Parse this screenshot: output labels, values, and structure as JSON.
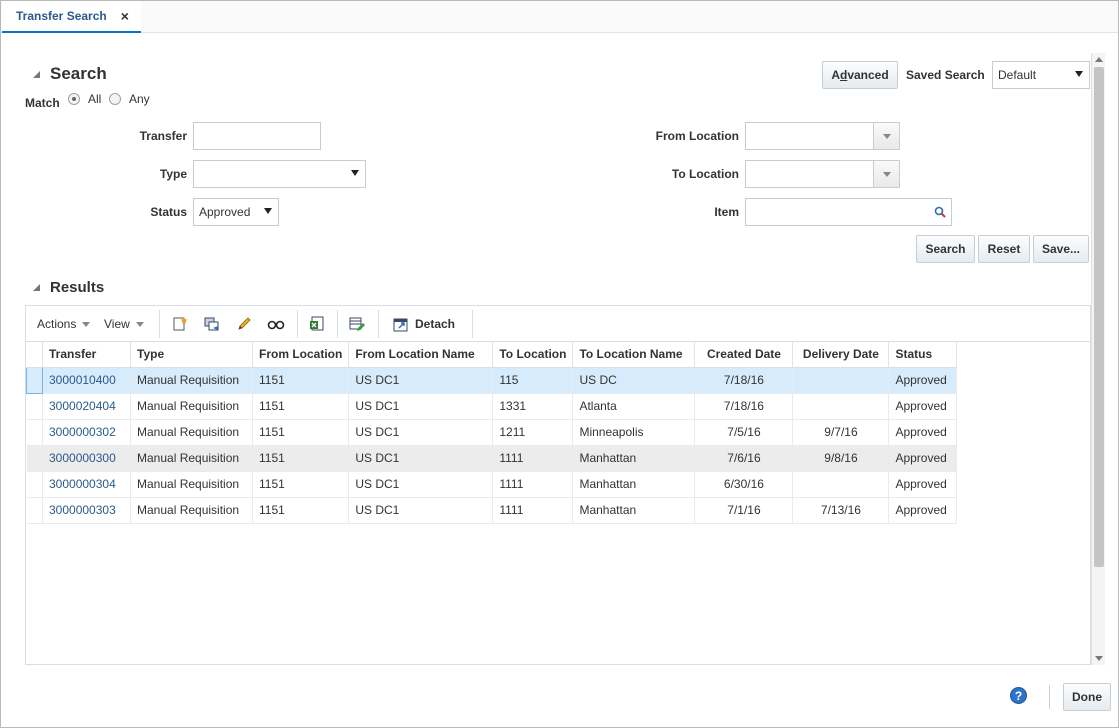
{
  "tab": {
    "label": "Transfer Search",
    "close_glyph": "×"
  },
  "search": {
    "title": "Search",
    "advanced_label_pre": "A",
    "advanced_label_u": "d",
    "advanced_label_post": "vanced",
    "saved_search_label": "Saved Search",
    "saved_search_value": "Default",
    "match_label": "Match",
    "match_all": "All",
    "match_any": "Any",
    "match_selected": "All",
    "fields": {
      "transfer_label": "Transfer",
      "transfer_value": "",
      "type_label": "Type",
      "type_value": "",
      "status_label": "Status",
      "status_value": "Approved",
      "from_location_label": "From Location",
      "from_location_value": "",
      "to_location_label": "To Location",
      "to_location_value": "",
      "item_label": "Item",
      "item_value": ""
    },
    "buttons": {
      "search": "Search",
      "reset": "Reset",
      "save": "Save..."
    }
  },
  "results": {
    "title": "Results",
    "toolbar": {
      "actions": "Actions",
      "view": "View",
      "detach": "Detach"
    },
    "columns": [
      "Transfer",
      "Type",
      "From Location",
      "From Location Name",
      "To Location",
      "To Location Name",
      "Created Date",
      "Delivery Date",
      "Status"
    ],
    "rows": [
      {
        "transfer": "3000010400",
        "type": "Manual Requisition",
        "from_loc": "1151",
        "from_name": "US DC1",
        "to_loc": "115",
        "to_name": "US DC",
        "created": "7/18/16",
        "delivery": "",
        "status": "Approved"
      },
      {
        "transfer": "3000020404",
        "type": "Manual Requisition",
        "from_loc": "1151",
        "from_name": "US DC1",
        "to_loc": "1331",
        "to_name": "Atlanta",
        "created": "7/18/16",
        "delivery": "",
        "status": "Approved"
      },
      {
        "transfer": "3000000302",
        "type": "Manual Requisition",
        "from_loc": "1151",
        "from_name": "US DC1",
        "to_loc": "1211",
        "to_name": "Minneapolis",
        "created": "7/5/16",
        "delivery": "9/7/16",
        "status": "Approved"
      },
      {
        "transfer": "3000000300",
        "type": "Manual Requisition",
        "from_loc": "1151",
        "from_name": "US DC1",
        "to_loc": "1111",
        "to_name": "Manhattan",
        "created": "7/6/16",
        "delivery": "9/8/16",
        "status": "Approved"
      },
      {
        "transfer": "3000000304",
        "type": "Manual Requisition",
        "from_loc": "1151",
        "from_name": "US DC1",
        "to_loc": "1111",
        "to_name": "Manhattan",
        "created": "6/30/16",
        "delivery": "",
        "status": "Approved"
      },
      {
        "transfer": "3000000303",
        "type": "Manual Requisition",
        "from_loc": "1151",
        "from_name": "US DC1",
        "to_loc": "1111",
        "to_name": "Manhattan",
        "created": "7/1/16",
        "delivery": "7/13/16",
        "status": "Approved"
      }
    ],
    "selected_row": 0,
    "hover_row": 3
  },
  "footer": {
    "help_glyph": "?",
    "done": "Done"
  },
  "colors": {
    "link": "#2c5a8c",
    "selected_row": "#d6ebfb",
    "tab_underline": "#0572ce",
    "help": "#2e73c5"
  },
  "icons": [
    "create-icon",
    "create-from-existing-icon",
    "edit-icon",
    "view-icon",
    "export-excel-icon",
    "edit-columns-icon",
    "detach-icon",
    "search-icon",
    "help-icon"
  ]
}
